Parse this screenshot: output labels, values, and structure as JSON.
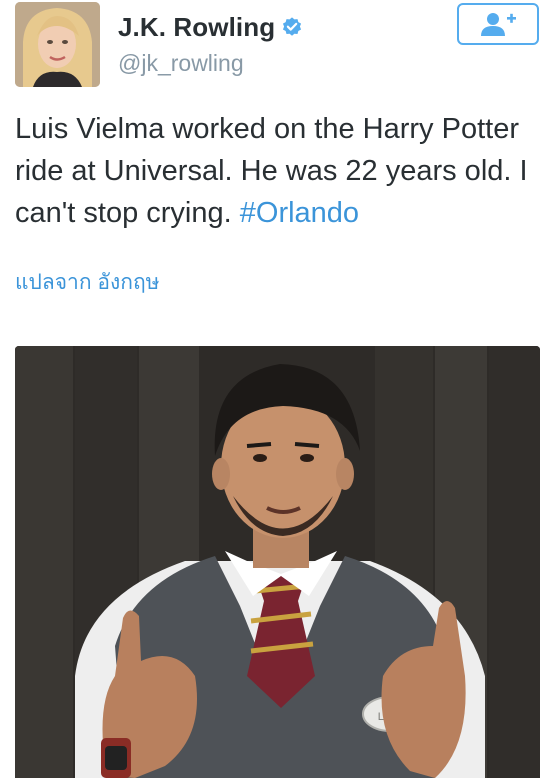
{
  "header": {
    "display_name": "J.K. Rowling",
    "handle": "@jk_rowling",
    "verified_icon": "verified-badge-icon",
    "follow_icon": "add-user-icon"
  },
  "tweet": {
    "text_before": "Luis Vielma worked on the Harry Potter ride at Universal. He was 22 years old. I can't stop crying.",
    "hashtag": "#Orlando",
    "translate_label": "แปลจาก อังกฤษ"
  },
  "photo": {
    "name_tag": "LUIS"
  },
  "colors": {
    "link": "#3b94d9",
    "verified": "#55acee",
    "text": "#292f33",
    "secondary": "#8899a6"
  }
}
